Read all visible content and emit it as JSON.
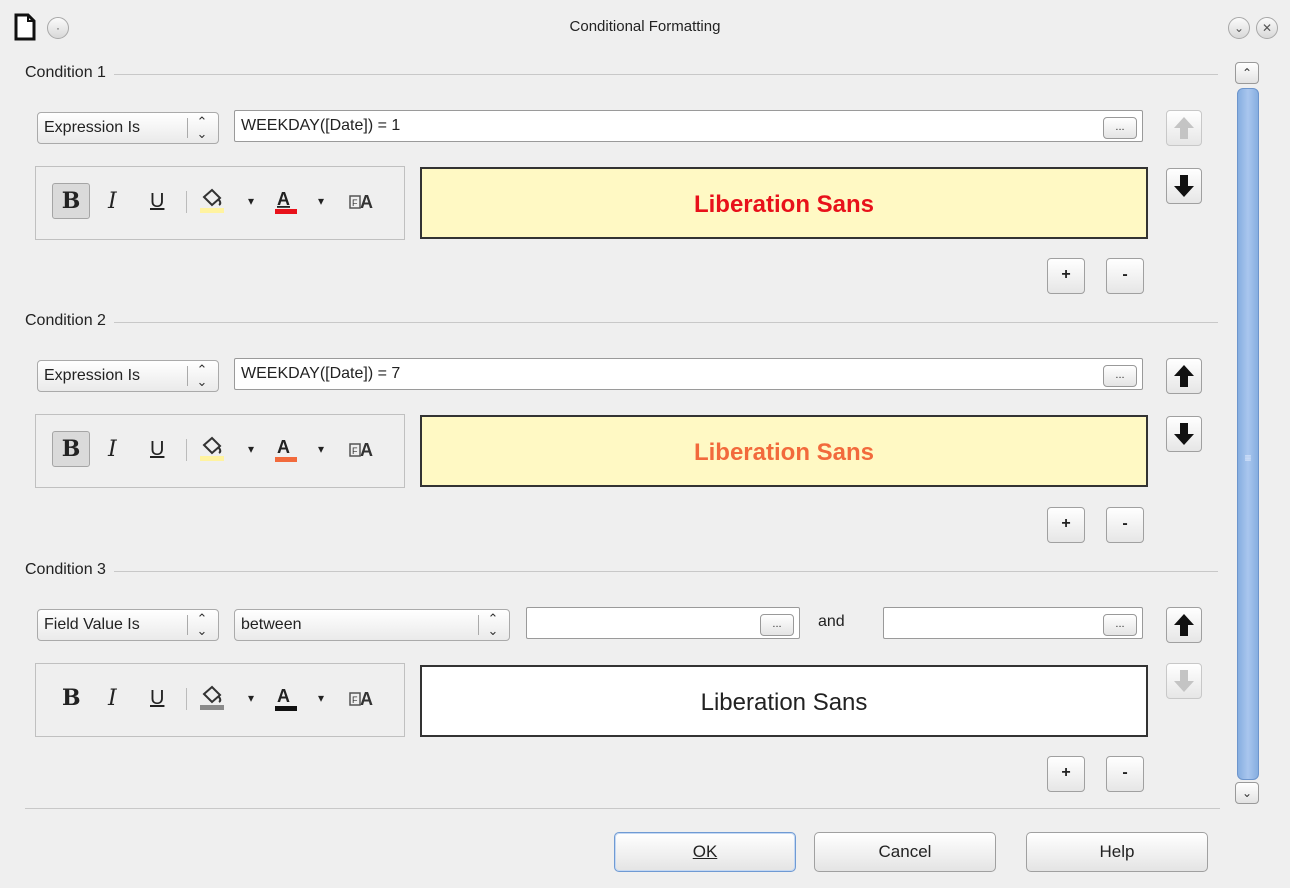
{
  "window": {
    "title": "Conditional Formatting"
  },
  "conditions": [
    {
      "label": "Condition 1",
      "type": "Expression Is",
      "expression": "WEEKDAY([Date]) = 1",
      "ellipsis": "...",
      "preview_text": "Liberation Sans",
      "preview_color": "#e8111a",
      "bold": true,
      "up_enabled": false,
      "down_enabled": true
    },
    {
      "label": "Condition 2",
      "type": "Expression Is",
      "expression": "WEEKDAY([Date]) = 7",
      "ellipsis": "...",
      "preview_text": "Liberation Sans",
      "preview_color": "#f26a3c",
      "bold": true,
      "up_enabled": true,
      "down_enabled": true
    },
    {
      "label": "Condition 3",
      "type": "Field Value Is",
      "operator": "between",
      "value1": "",
      "and_label": "and",
      "value2": "",
      "ellipsis": "...",
      "preview_text": "Liberation Sans",
      "preview_color": "#222222",
      "bold": false,
      "up_enabled": true,
      "down_enabled": false
    }
  ],
  "toolbar": {
    "bold": "B",
    "italic": "I",
    "underline": "U"
  },
  "buttons": {
    "add": "+",
    "remove": "-",
    "ok": "OK",
    "cancel": "Cancel",
    "help": "Help"
  },
  "colors": {
    "preview_bg": "#fff9c4",
    "scroll_thumb": "#93b6e6"
  }
}
